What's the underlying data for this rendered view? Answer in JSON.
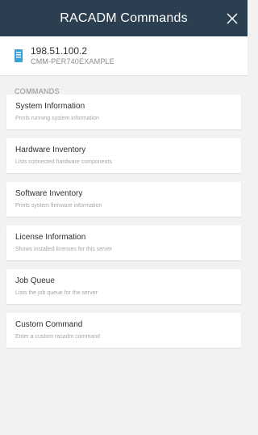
{
  "header": {
    "title": "RACADM Commands",
    "close_icon": "close-icon"
  },
  "host": {
    "icon": "server-icon",
    "ip": "198.51.100.2",
    "name": "CMM-PER740EXAMPLE"
  },
  "commands_section": {
    "label": "COMMANDS"
  },
  "commands": [
    {
      "title": "System Information",
      "description": "Prints running system information"
    },
    {
      "title": "Hardware Inventory",
      "description": "Lists connected hardware components"
    },
    {
      "title": "Software Inventory",
      "description": "Prints system firmware information"
    },
    {
      "title": "License Information",
      "description": "Shows installed licenses for this server"
    },
    {
      "title": "Job Queue",
      "description": "Lists the job queue for the server"
    },
    {
      "title": "Custom Command",
      "description": "Enter a custom racadm command"
    }
  ],
  "colors": {
    "header_bg": "#2b3f50",
    "accent": "#3aa0d8",
    "background": "#f2f2f2"
  }
}
